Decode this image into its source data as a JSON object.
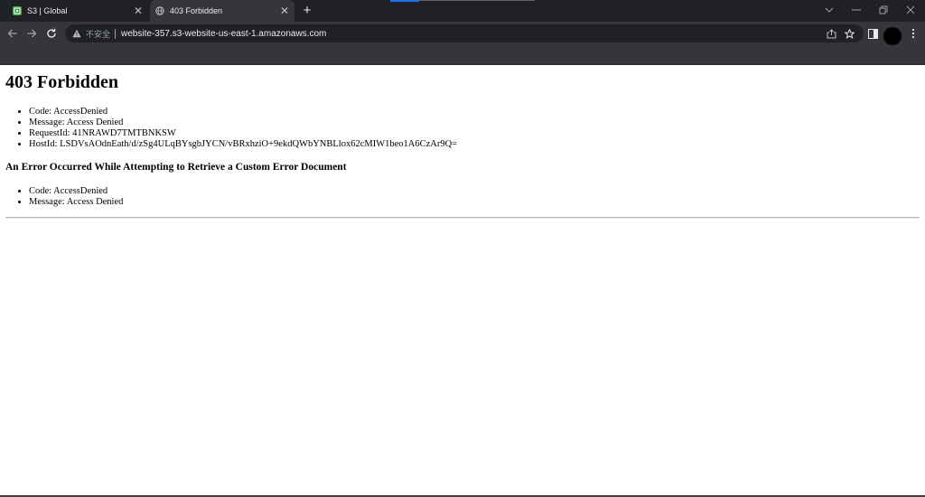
{
  "browser": {
    "tabs": [
      {
        "title": "S3 | Global",
        "icon": "s3-icon",
        "active": false
      },
      {
        "title": "403 Forbidden",
        "icon": "globe-icon",
        "active": true
      }
    ],
    "new_tab_label": "+",
    "address_bar": {
      "security_label": "不安全",
      "url": "website-357.s3-website-us-east-1.amazonaws.com"
    },
    "window_controls": [
      "chevron-down-icon",
      "minimize-icon",
      "restore-icon",
      "close-icon"
    ],
    "colors": {
      "tabstrip": "#202124",
      "toolbar": "#35363a",
      "omnibox": "#202124",
      "accent": "#1a73e8"
    }
  },
  "page": {
    "title": "403 Forbidden",
    "details": [
      "Code: AccessDenied",
      "Message: Access Denied",
      "RequestId: 41NRAWD7TMTBNKSW",
      "HostId: LSDVsAOdnEath/d/zSg4ULqBYsgbJYCN/vBRxhziO+9ekdQWbYNBLlox62cMIW1beo1A6CzAr9Q="
    ],
    "custom_error_heading": "An Error Occurred While Attempting to Retrieve a Custom Error Document",
    "custom_error_details": [
      "Code: AccessDenied",
      "Message: Access Denied"
    ]
  }
}
